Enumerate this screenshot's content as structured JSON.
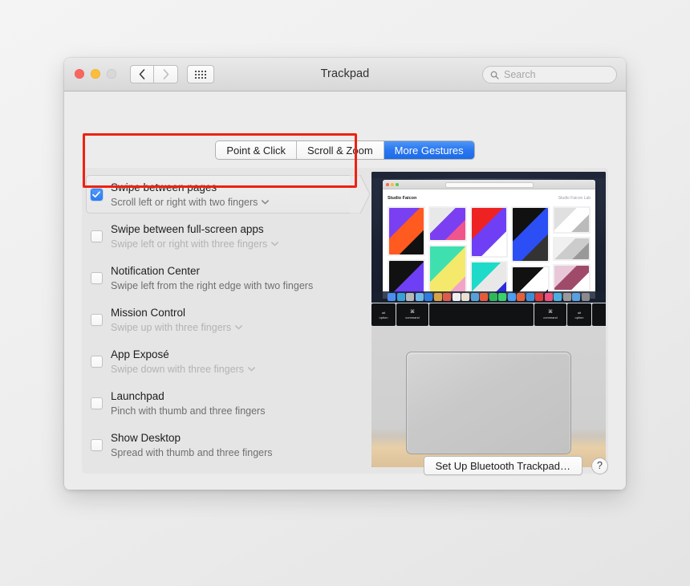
{
  "window": {
    "title": "Trackpad",
    "traffic_lights": [
      {
        "name": "close",
        "color": "#f9665e"
      },
      {
        "name": "minimize",
        "color": "#fbbd3a"
      },
      {
        "name": "zoom",
        "color": "#d8d8d8"
      }
    ],
    "nav": {
      "back": "‹",
      "forward": "›",
      "grid": "show-all-icon"
    },
    "search": {
      "placeholder": "Search",
      "value": "",
      "icon": "search-icon"
    }
  },
  "tabs": [
    {
      "label": "Point & Click",
      "selected": false
    },
    {
      "label": "Scroll & Zoom",
      "selected": false
    },
    {
      "label": "More Gestures",
      "selected": true
    }
  ],
  "accent_color": "#2f7df0",
  "annotation_color": "#ee2211",
  "gestures": [
    {
      "title": "Swipe between pages",
      "subtitle": "Scroll left or right with two fingers",
      "checked": true,
      "selected": true,
      "has_dropdown": true,
      "dim_subtitle": false
    },
    {
      "title": "Swipe between full-screen apps",
      "subtitle": "Swipe left or right with three fingers",
      "checked": false,
      "selected": false,
      "has_dropdown": true,
      "dim_subtitle": true
    },
    {
      "title": "Notification Center",
      "subtitle": "Swipe left from the right edge with two fingers",
      "checked": false,
      "selected": false,
      "has_dropdown": false,
      "dim_subtitle": false
    },
    {
      "title": "Mission Control",
      "subtitle": "Swipe up with three fingers",
      "checked": false,
      "selected": false,
      "has_dropdown": true,
      "dim_subtitle": true
    },
    {
      "title": "App Exposé",
      "subtitle": "Swipe down with three fingers",
      "checked": false,
      "selected": false,
      "has_dropdown": true,
      "dim_subtitle": true
    },
    {
      "title": "Launchpad",
      "subtitle": "Pinch with thumb and three fingers",
      "checked": false,
      "selected": false,
      "has_dropdown": false,
      "dim_subtitle": false
    },
    {
      "title": "Show Desktop",
      "subtitle": "Spread with thumb and three fingers",
      "checked": false,
      "selected": false,
      "has_dropdown": false,
      "dim_subtitle": false
    }
  ],
  "preview": {
    "name": "gesture-demo-video",
    "site_brand": "Studio Faicon",
    "site_nav_right": "Studio Faicon Lab",
    "cards": [
      {
        "c1": "#7b3ff2",
        "c2": "#ff5a1f",
        "c3": "#111111",
        "h": 58
      },
      {
        "c1": "#111111",
        "c2": "#6f3ff5",
        "c3": "#222222",
        "h": 74
      },
      {
        "c1": "#e8e8e8",
        "c2": "#7b3ff2",
        "c3": "#f0558c",
        "h": 40
      },
      {
        "c1": "#3fe0b0",
        "c2": "#f4e96b",
        "c3": "#f0a5c8",
        "h": 72
      },
      {
        "c1": "#ff6a2a",
        "c2": "#1a1a1a",
        "c3": "#dddddd",
        "h": 34
      },
      {
        "c1": "#ee2222",
        "c2": "#6f3ff5",
        "c3": "#ffffff",
        "h": 60
      },
      {
        "c1": "#1ddbc8",
        "c2": "#e8e8e8",
        "c3": "#2b2bdd",
        "h": 52
      },
      {
        "c1": "#111111",
        "c2": "#2b4ef5",
        "c3": "#333333",
        "h": 66
      },
      {
        "c1": "#111111",
        "c2": "#ffffff",
        "c3": "#222222",
        "h": 58
      },
      {
        "c1": "#7b2f6a",
        "c2": "#e6e6e6",
        "c3": "#3a8f3a",
        "h": 38
      },
      {
        "c1": "#e0e0e0",
        "c2": "#ffffff",
        "c3": "#bbbbbb",
        "h": 30
      },
      {
        "c1": "#f0f0f0",
        "c2": "#cccccc",
        "c3": "#999999",
        "h": 26
      },
      {
        "c1": "#e8c8d8",
        "c2": "#a04a6a",
        "c3": "#ffffff",
        "h": 30
      },
      {
        "c1": "#ffffff",
        "c2": "#2bbb55",
        "c3": "#dddddd",
        "h": 26
      },
      {
        "c1": "#111111",
        "c2": "#ff8a2a",
        "c3": "#444444",
        "h": 24
      }
    ],
    "dock_icons": [
      "#4b8ef0",
      "#3aa0d8",
      "#b8b8b8",
      "#6fb8e8",
      "#2f7de0",
      "#d8a14a",
      "#e05a4a",
      "#efefef",
      "#e8e0d0",
      "#5aa0d8",
      "#e85a3a",
      "#2fb85a",
      "#3ad06a",
      "#4b9ef0",
      "#e8603a",
      "#3f8fd8",
      "#e03a3a",
      "#f0507a",
      "#4bb0e0",
      "#9a9a9a",
      "#5a9fe0",
      "#8a8a90"
    ],
    "keys": [
      {
        "top": "alt",
        "bottom": "option",
        "w": 30
      },
      {
        "top": "⌘",
        "bottom": "command",
        "w": 40
      },
      {
        "top": "",
        "bottom": "",
        "w": 130
      },
      {
        "top": "⌘",
        "bottom": "command",
        "w": 40
      },
      {
        "top": "alt",
        "bottom": "option",
        "w": 30
      },
      {
        "top": "",
        "bottom": "",
        "w": 20
      }
    ]
  },
  "bottom": {
    "setup_button": "Set Up Bluetooth Trackpad…",
    "help_button": "?"
  }
}
